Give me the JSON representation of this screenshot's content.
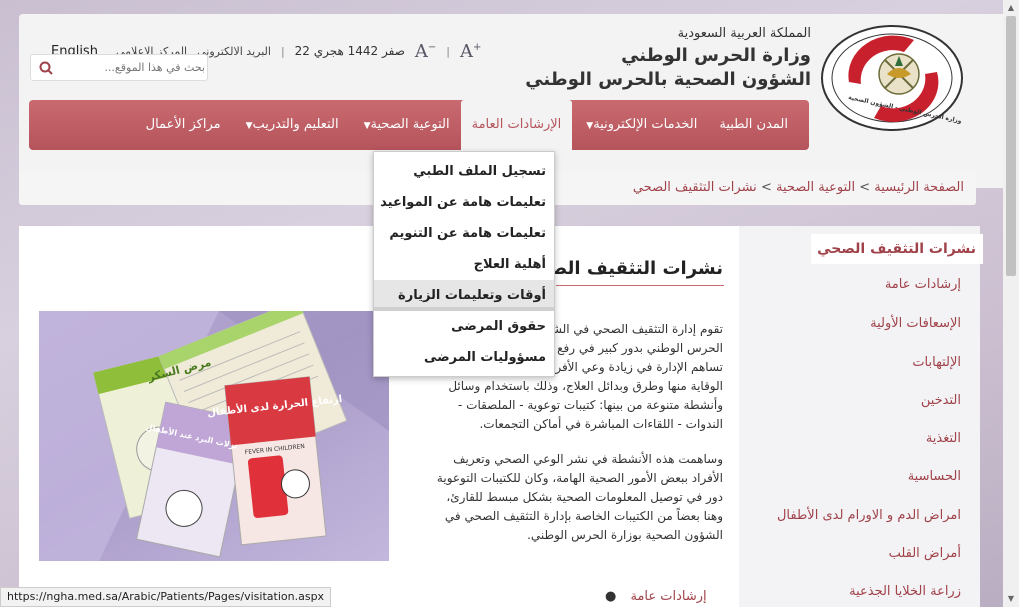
{
  "header": {
    "org_line1": "المملكة العربية السعودية",
    "org_line2": "وزارة الحرس الوطني",
    "org_line3": "الشؤون الصحية بالحرس الوطني",
    "logo_text": "وزارة الحرس الوطني - الشؤون الصحية",
    "topbar": {
      "english": "English",
      "media_center": "المركز الاعلامي",
      "email": "البريد الالكتروني",
      "date": "22 صفر 1442 هجري",
      "font_decrease": "A",
      "font_increase": "A"
    },
    "search": {
      "placeholder": "بحث في هذا الموقع..."
    }
  },
  "nav": {
    "items": [
      {
        "label": "المدن الطبية",
        "caret": false
      },
      {
        "label": "الخدمات الإلكترونية",
        "caret": true
      },
      {
        "label": "الإرشادات العامة",
        "caret": false,
        "active": true
      },
      {
        "label": "التوعية الصحية",
        "caret": true
      },
      {
        "label": "التعليم والتدريب",
        "caret": true
      },
      {
        "label": "مراكز الأعمال",
        "caret": false
      }
    ]
  },
  "dropdown": {
    "items": [
      "تسجيل الملف الطبي",
      "تعليمات هامة عن المواعيد",
      "تعليمات هامة عن التنويم",
      "أهلية العلاج",
      "أوقات وتعليمات الزيارة",
      "حقوق المرضى",
      "مسؤوليات المرضى"
    ],
    "hover_index": 4
  },
  "breadcrumb": {
    "home": "الصفحة الرئيسية",
    "sep": ">",
    "section": "التوعية الصحية",
    "current": "نشرات التثقيف الصحي"
  },
  "main": {
    "title": "نشرات التثقيف الصحي",
    "para1_lines": [
      "تقوم إدارة التثقيف الصحي في الشؤون الصحية بالحرس الوطني",
      "الحرس الوطني بدور كبير في رفع مستوى الوعي الصحي، حيث",
      "تساهم الإدارة في زيادة وعي الأفراد بالأمراض وأسبابها وطرق",
      "الوقاية منها وطرق وبدائل العلاج، وذلك باستخدام وسائل",
      "وأنشطة متنوعة من بينها: كتيبات توعوية - الملصقات -",
      "الندوات - اللقاءات المباشرة في أماكن التجمعات."
    ],
    "para2_lines": [
      "وساهمت هذه الأنشطة في نشر الوعي الصحي وتعريف",
      "الأفراد ببعض الأمور الصحية الهامة، وكان للكتيبات التوعوية",
      "دور في توصيل المعلومات الصحية بشكل مبسط للقارئ،",
      "وهنا بعضاً من الكتيبات الخاصة بإدارة التثقيف الصحي في",
      "الشؤون الصحية بوزارة الحرس الوطني."
    ],
    "bullet": "إرشادات عامة",
    "brochures": {
      "b1": "مرض السكر",
      "b2": "ارتفاع الحرارة لدى الأطفال",
      "b2_en": "FEVER IN CHILDREN",
      "b3": "نزلات البرد عند الأطفال"
    }
  },
  "sidebar": {
    "title": "نشرات التثقيف الصحي",
    "items": [
      "إرشادات عامة",
      "الإسعافات الأولية",
      "الإلتهابات",
      "التدخين",
      "التغذية",
      "الحساسية",
      "امراض الدم و الاورام لدى الأطفال",
      "أمراض القلب",
      "زراعة الخلايا الجذعية"
    ]
  },
  "status_url": "https://ngha.med.sa/Arabic/Patients/Pages/visitation.aspx",
  "colors": {
    "brand_red": "#b5545b",
    "link_red": "#a0424a"
  }
}
